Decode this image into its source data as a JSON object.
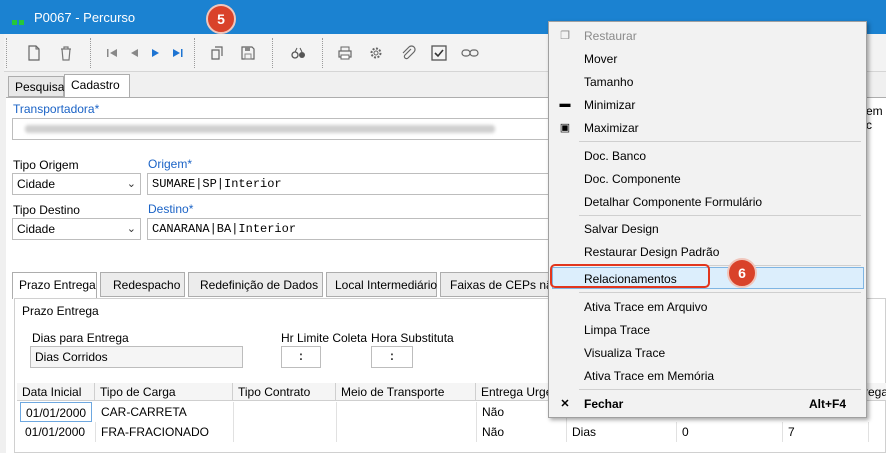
{
  "window": {
    "title": "P0067 - Percurso"
  },
  "badges": {
    "step5": "5",
    "step6": "6"
  },
  "toolbar": {
    "buttons": [
      "new-doc-icon",
      "delete-icon",
      "first-icon",
      "prev-icon",
      "next-icon",
      "last-icon",
      "copy-icon",
      "save-icon",
      "binoculars-icon",
      "print-icon",
      "gear-icon",
      "attach-icon",
      "check-icon",
      "link-icon"
    ]
  },
  "top_tabs": [
    "Pesquisa",
    "Cadastro"
  ],
  "form": {
    "transportadora_label": "Transportadora*",
    "tipo_origem_label": "Tipo Origem",
    "tipo_origem_value": "Cidade",
    "origem_label": "Origem*",
    "origem_value": "SUMARE|SP|Interior",
    "tipo_destino_label": "Tipo Destino",
    "tipo_destino_value": "Cidade",
    "destino_label": "Destino*",
    "destino_value": "CANARANA|BA|Interior",
    "right_clip_label": "em c"
  },
  "sub_tabs": [
    "Prazo Entrega",
    "Redespacho",
    "Redefinição de Dados",
    "Local Intermediário",
    "Faixas de CEPs nã"
  ],
  "prazo": {
    "group_title": "Prazo Entrega",
    "dias_label": "Dias para Entrega",
    "dias_value": "Dias Corridos",
    "hr_limite_label": "Hr Limite Coleta",
    "hr_limite_value": ":",
    "hora_subst_label": "Hora Substituta",
    "hora_subst_value": ":"
  },
  "grid": {
    "headers": [
      "Data Inicial",
      "Tipo de Carga",
      "Tipo Contrato",
      "Meio de Transporte",
      "Entrega Urge",
      "rega"
    ],
    "rows": [
      [
        "01/01/2000",
        "CAR-CARRETA",
        "",
        "",
        "Não",
        "",
        "",
        ""
      ],
      [
        "01/01/2000",
        "FRA-FRACIONADO",
        "",
        "",
        "Não",
        "Dias",
        "0",
        "7"
      ]
    ]
  },
  "context_menu": {
    "items": [
      {
        "label": "Restaurar",
        "icon": "restore-icon",
        "disabled": true
      },
      {
        "label": "Mover"
      },
      {
        "label": "Tamanho"
      },
      {
        "label": "Minimizar",
        "icon": "minimize-icon"
      },
      {
        "label": "Maximizar",
        "icon": "maximize-icon"
      },
      {
        "label": "Doc. Banco"
      },
      {
        "label": "Doc. Componente"
      },
      {
        "label": "Detalhar Componente Formulário"
      },
      {
        "label": "Salvar Design"
      },
      {
        "label": "Restaurar Design Padrão"
      },
      {
        "label": "Relacionamentos",
        "highlighted": true
      },
      {
        "label": "Ativa Trace em Arquivo"
      },
      {
        "label": "Limpa Trace"
      },
      {
        "label": "Visualiza Trace"
      },
      {
        "label": "Ativa Trace em Memória"
      },
      {
        "label": "Fechar",
        "icon": "close-icon",
        "shortcut": "Alt+F4"
      }
    ]
  }
}
